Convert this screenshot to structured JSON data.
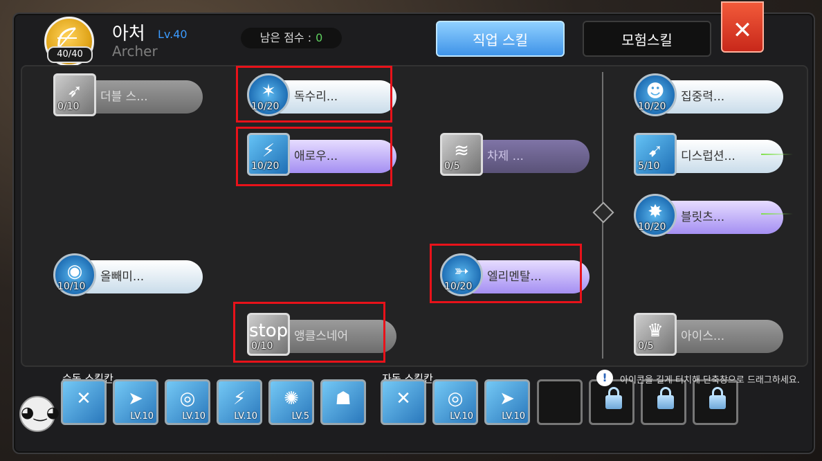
{
  "header": {
    "class_name": "아처",
    "class_level": "Lv.40",
    "class_sub": "Archer",
    "hp": "40/40",
    "points_label": "남은 점수 :",
    "points_value": "0",
    "tab_job": "직업 스킬",
    "tab_adventure": "모험스킬",
    "close_symbol": "✕"
  },
  "skills": [
    {
      "name": "더블 스...",
      "level": "0/10",
      "style": "gray",
      "icon": "bow-icon",
      "glyph": "➶"
    },
    {
      "name": "독수리...",
      "level": "10/20",
      "style": "light",
      "icon": "eagle-icon",
      "glyph": "✶"
    },
    {
      "name": "애로우...",
      "level": "10/20",
      "style": "purple",
      "icon": "arrows-icon",
      "glyph": "⚡"
    },
    {
      "name": "차제 ...",
      "level": "0/5",
      "style": "darkpurple",
      "icon": "slash-icon",
      "glyph": "≋"
    },
    {
      "name": "집중력...",
      "level": "10/20",
      "style": "light",
      "icon": "headband-icon",
      "glyph": "☻"
    },
    {
      "name": "디스럽션...",
      "level": "5/10",
      "style": "light",
      "icon": "disruption-icon",
      "glyph": "➹"
    },
    {
      "name": "블릿츠...",
      "level": "10/20",
      "style": "purple",
      "icon": "blitz-icon",
      "glyph": "✸"
    },
    {
      "name": "올빼미...",
      "level": "10/10",
      "style": "light",
      "icon": "eye-icon",
      "glyph": "◉"
    },
    {
      "name": "엘리멘탈...",
      "level": "10/20",
      "style": "purple",
      "icon": "elemental-icon",
      "glyph": "➳"
    },
    {
      "name": "앵클스네어",
      "level": "0/10",
      "style": "gray",
      "icon": "stop-snare-icon",
      "glyph": "stop"
    },
    {
      "name": "아이스...",
      "level": "0/5",
      "style": "gray",
      "icon": "ice-crown-icon",
      "glyph": "♛"
    }
  ],
  "manual_bar": {
    "label": "수동 스킬칸",
    "slots": [
      {
        "icon": "broken-sword-icon",
        "glyph": "✕",
        "level": ""
      },
      {
        "icon": "dash-figure-icon",
        "glyph": "➤",
        "level": "LV.10"
      },
      {
        "icon": "shield-swirl-icon",
        "glyph": "◎",
        "level": "LV.10"
      },
      {
        "icon": "arrows-icon",
        "glyph": "⚡",
        "level": "LV.10"
      },
      {
        "icon": "burst-icon",
        "glyph": "✺",
        "level": "LV.5"
      },
      {
        "icon": "rest-icon",
        "glyph": "☗",
        "level": ""
      }
    ]
  },
  "auto_bar": {
    "label": "자동 스킬칸",
    "slots": [
      {
        "icon": "broken-sword-icon",
        "glyph": "✕",
        "level": ""
      },
      {
        "icon": "shield-swirl-icon",
        "glyph": "◎",
        "level": "LV.10"
      },
      {
        "icon": "dash-figure-icon",
        "glyph": "➤",
        "level": "LV.10"
      }
    ]
  },
  "hint": "아이콘을 길게 터치해 단축창으로 드래그하세요.",
  "hint_symbol": "!",
  "avatar_glyph": "◕‿◕"
}
